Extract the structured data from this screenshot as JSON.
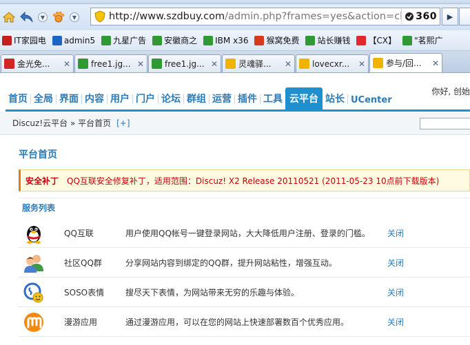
{
  "browser": {
    "url_host": "http://www.szdbuy.com",
    "url_path": "/admin.php?frames=yes&action=cloud&",
    "engine_label": "360",
    "bookmarks": [
      {
        "label": "IT家园电",
        "color": "#c81d1d"
      },
      {
        "label": "admin5",
        "color": "#1a66c2"
      },
      {
        "label": "九星广告",
        "color": "#2f9a34"
      },
      {
        "label": "安徽商之",
        "color": "#2f9a34"
      },
      {
        "label": "IBM x36",
        "color": "#2f9a34"
      },
      {
        "label": "猴窝免费",
        "color": "#d53a1c"
      },
      {
        "label": "站长赚钱",
        "color": "#2f9a34"
      },
      {
        "label": "【CX】",
        "color": "#e2282d"
      },
      {
        "label": "\"茗熙广",
        "color": "#2f9a34"
      }
    ],
    "tabs": [
      {
        "label": "金光免...",
        "icon_color": "#d22626",
        "active": false
      },
      {
        "label": "free1.jg...",
        "icon_color": "#2f9a34",
        "active": false
      },
      {
        "label": "free1.jg...",
        "icon_color": "#2f9a34",
        "active": false
      },
      {
        "label": "灵魂驿...",
        "icon_color": "#f0b400",
        "active": false
      },
      {
        "label": "lovecxr...",
        "icon_color": "#f0b400",
        "active": false
      },
      {
        "label": "参与/回...",
        "icon_color": "#f0b400",
        "active": true
      }
    ],
    "close_glyph": "✕"
  },
  "admin": {
    "greeting": "你好, 创始",
    "nav": [
      {
        "label": "首页",
        "active": false
      },
      {
        "label": "全局",
        "active": false
      },
      {
        "label": "界面",
        "active": false
      },
      {
        "label": "内容",
        "active": false
      },
      {
        "label": "用户",
        "active": false
      },
      {
        "label": "门户",
        "active": false
      },
      {
        "label": "论坛",
        "active": false
      },
      {
        "label": "群组",
        "active": false
      },
      {
        "label": "运营",
        "active": false
      },
      {
        "label": "插件",
        "active": false
      },
      {
        "label": "工具",
        "active": false
      },
      {
        "label": "云平台",
        "active": true
      },
      {
        "label": "站长",
        "active": false
      },
      {
        "label": "UCenter",
        "active": false
      }
    ],
    "breadcrumb": "Discuz!云平台 » 平台首页",
    "breadcrumb_plus": "[+]",
    "page_title": "平台首页",
    "notice_label": "安全补丁",
    "notice_text": "QQ互联安全修复补丁，适用范围：Discuz! X2 Release 20110521 (2011-05-23 10点前下载版本)",
    "section_title": "服务列表",
    "services": [
      {
        "name": "QQ互联",
        "desc": "用户使用QQ帐号一键登录网站，大大降低用户注册、登录的门槛。",
        "action": "关闭",
        "icon": "qq-penguin-icon"
      },
      {
        "name": "社区QQ群",
        "desc": "分享网站内容到绑定的QQ群，提升网站粘性，增强互动。",
        "action": "关闭",
        "icon": "qq-group-icon"
      },
      {
        "name": "SOSO表情",
        "desc": "搜尽天下表情，为网站带来无穷的乐趣与体验。",
        "action": "关闭",
        "icon": "soso-smiley-icon"
      },
      {
        "name": "漫游应用",
        "desc": "通过漫游应用，可以在您的网站上快速部署数百个优秀应用。",
        "action": "关闭",
        "icon": "manyou-icon"
      }
    ]
  }
}
